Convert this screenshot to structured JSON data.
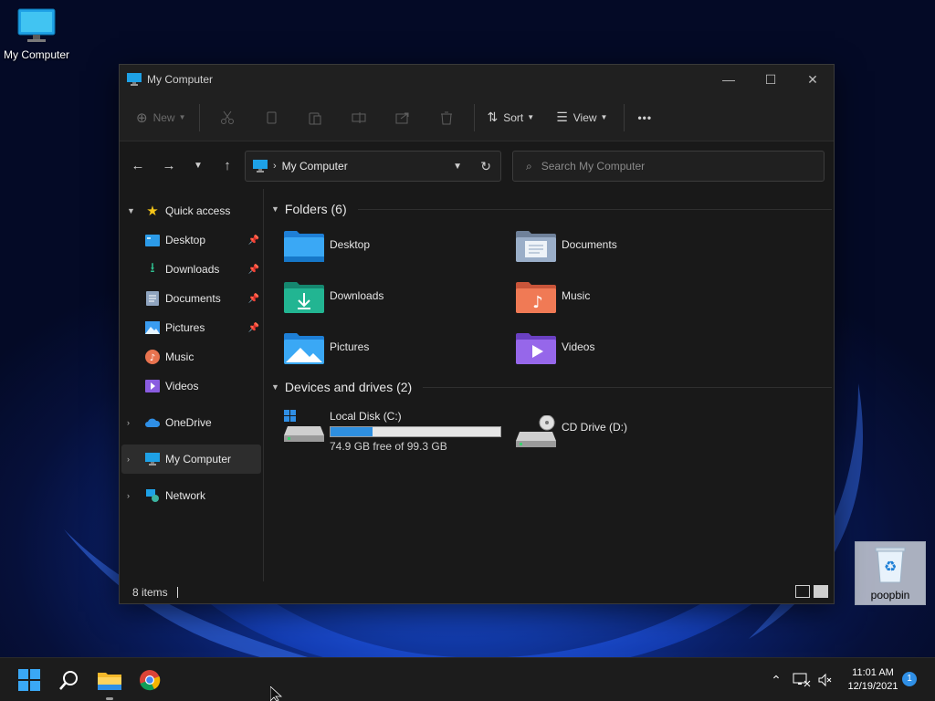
{
  "desktop": {
    "icons": [
      {
        "label": "My Computer",
        "icon": "monitor-icon"
      },
      {
        "label": "poopbin",
        "icon": "recycle-bin-icon"
      }
    ]
  },
  "window": {
    "title": "My Computer",
    "controls": {
      "minimize": "—",
      "maximize": "☐",
      "close": "✕"
    }
  },
  "toolbar": {
    "new_label": "New",
    "sort_label": "Sort",
    "view_label": "View",
    "more_label": "•••",
    "icons": [
      "cut-icon",
      "copy-icon",
      "paste-icon",
      "rename-icon",
      "share-icon",
      "delete-icon"
    ]
  },
  "navbar": {
    "address": "My Computer",
    "search_placeholder": "Search My Computer"
  },
  "sidebar": {
    "quick_access": "Quick access",
    "items": [
      {
        "label": "Desktop",
        "pinned": true,
        "icon": "desktop-folder-icon"
      },
      {
        "label": "Downloads",
        "pinned": true,
        "icon": "downloads-icon"
      },
      {
        "label": "Documents",
        "pinned": true,
        "icon": "documents-icon"
      },
      {
        "label": "Pictures",
        "pinned": true,
        "icon": "pictures-icon"
      },
      {
        "label": "Music",
        "pinned": false,
        "icon": "music-icon"
      },
      {
        "label": "Videos",
        "pinned": false,
        "icon": "videos-icon"
      }
    ],
    "onedrive": "OneDrive",
    "my_computer": "My Computer",
    "network": "Network"
  },
  "content": {
    "folders_header": "Folders (6)",
    "folders": [
      {
        "name": "Desktop",
        "color": "#3aa0f0"
      },
      {
        "name": "Documents",
        "color": "#8fa4bf"
      },
      {
        "name": "Downloads",
        "color": "#1fa88a"
      },
      {
        "name": "Music",
        "color": "#e8734f"
      },
      {
        "name": "Pictures",
        "color": "#3a9cf0"
      },
      {
        "name": "Videos",
        "color": "#8a5ce0"
      }
    ],
    "drives_header": "Devices and drives (2)",
    "drives": [
      {
        "name": "Local Disk (C:)",
        "free_text": "74.9 GB free of 99.3 GB",
        "used_fraction": 0.246
      },
      {
        "name": "CD Drive (D:)"
      }
    ]
  },
  "status": {
    "items_text": "8 items"
  },
  "taskbar": {
    "time": "11:01 AM",
    "date": "12/19/2021",
    "notification_count": "1",
    "pinned": [
      "start-icon",
      "search-icon",
      "file-explorer-icon",
      "chrome-icon"
    ]
  },
  "colors": {
    "accent": "#2e8fe0",
    "window_bg": "#191919",
    "toolbar_bg": "#202020"
  }
}
